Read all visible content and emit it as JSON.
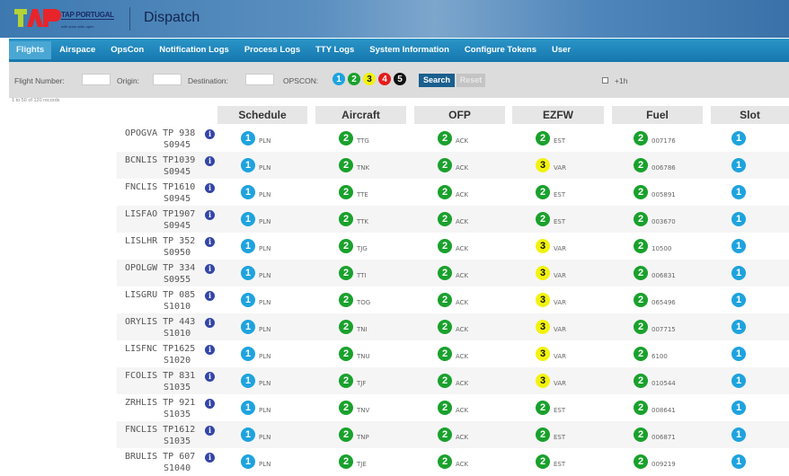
{
  "header": {
    "brand": "TAP PORTUGAL",
    "tagline": "with arms wide open",
    "app_title": "Dispatch",
    "logo_text": "TAP"
  },
  "nav": [
    "Flights",
    "Airspace",
    "OpsCon",
    "Notification Logs",
    "Process Logs",
    "TTY Logs",
    "System Information",
    "Configure Tokens",
    "User"
  ],
  "filters": {
    "flight_number": "Flight Number:",
    "origin": "Origin:",
    "destination": "Destination:",
    "opscon": "OPSCON:",
    "opscon_levels": [
      "1",
      "2",
      "3",
      "4",
      "5"
    ],
    "search": "Search",
    "reset": "Reset",
    "plus1h": "+1h"
  },
  "records": "1 to 50 of 120 records",
  "columns": [
    "Schedule",
    "Aircraft",
    "OFP",
    "EZFW",
    "Fuel",
    "Slot"
  ],
  "colors": {
    "1": "#1ea3de",
    "2": "#19a12c",
    "3": "#f2f20f",
    "4": "#e51d1d",
    "5": "#111111"
  },
  "rows": [
    {
      "route": "OPOGVA",
      "flight": "TP 938",
      "std": "S0945",
      "sched": [
        "1",
        "PLN"
      ],
      "ac": [
        "2",
        "TTG"
      ],
      "ofp": [
        "2",
        "ACK"
      ],
      "ezfw": [
        "2",
        "EST"
      ],
      "fuel": [
        "2",
        "007176"
      ],
      "slot": [
        "1",
        ""
      ]
    },
    {
      "route": "BCNLIS",
      "flight": "TP1039",
      "std": "S0945",
      "sched": [
        "1",
        "PLN"
      ],
      "ac": [
        "2",
        "TNK"
      ],
      "ofp": [
        "2",
        "ACK"
      ],
      "ezfw": [
        "3",
        "VAR"
      ],
      "fuel": [
        "2",
        "006786"
      ],
      "slot": [
        "1",
        ""
      ]
    },
    {
      "route": "FNCLIS",
      "flight": "TP1610",
      "std": "S0945",
      "sched": [
        "1",
        "PLN"
      ],
      "ac": [
        "2",
        "TTE"
      ],
      "ofp": [
        "2",
        "ACK"
      ],
      "ezfw": [
        "2",
        "EST"
      ],
      "fuel": [
        "2",
        "005891"
      ],
      "slot": [
        "1",
        ""
      ]
    },
    {
      "route": "LISFAO",
      "flight": "TP1907",
      "std": "S0945",
      "sched": [
        "1",
        "PLN"
      ],
      "ac": [
        "2",
        "TTK"
      ],
      "ofp": [
        "2",
        "ACK"
      ],
      "ezfw": [
        "2",
        "EST"
      ],
      "fuel": [
        "2",
        "003670"
      ],
      "slot": [
        "1",
        ""
      ]
    },
    {
      "route": "LISLHR",
      "flight": "TP 352",
      "std": "S0950",
      "sched": [
        "1",
        "PLN"
      ],
      "ac": [
        "2",
        "TJG"
      ],
      "ofp": [
        "2",
        "ACK"
      ],
      "ezfw": [
        "3",
        "VAR"
      ],
      "fuel": [
        "2",
        "10500"
      ],
      "slot": [
        "1",
        ""
      ]
    },
    {
      "route": "OPOLGW",
      "flight": "TP 334",
      "std": "S0955",
      "sched": [
        "1",
        "PLN"
      ],
      "ac": [
        "2",
        "TTI"
      ],
      "ofp": [
        "2",
        "ACK"
      ],
      "ezfw": [
        "3",
        "VAR"
      ],
      "fuel": [
        "2",
        "006831"
      ],
      "slot": [
        "1",
        ""
      ]
    },
    {
      "route": "LISGRU",
      "flight": "TP 085",
      "std": "S1010",
      "sched": [
        "1",
        "PLN"
      ],
      "ac": [
        "2",
        "TOG"
      ],
      "ofp": [
        "2",
        "ACK"
      ],
      "ezfw": [
        "3",
        "VAR"
      ],
      "fuel": [
        "2",
        "065496"
      ],
      "slot": [
        "1",
        ""
      ]
    },
    {
      "route": "ORYLIS",
      "flight": "TP 443",
      "std": "S1010",
      "sched": [
        "1",
        "PLN"
      ],
      "ac": [
        "2",
        "TNI"
      ],
      "ofp": [
        "2",
        "ACK"
      ],
      "ezfw": [
        "3",
        "VAR"
      ],
      "fuel": [
        "2",
        "007715"
      ],
      "slot": [
        "1",
        ""
      ]
    },
    {
      "route": "LISFNC",
      "flight": "TP1625",
      "std": "S1020",
      "sched": [
        "1",
        "PLN"
      ],
      "ac": [
        "2",
        "TNU"
      ],
      "ofp": [
        "2",
        "ACK"
      ],
      "ezfw": [
        "3",
        "VAR"
      ],
      "fuel": [
        "2",
        "6100"
      ],
      "slot": [
        "1",
        ""
      ]
    },
    {
      "route": "FCOLIS",
      "flight": "TP 831",
      "std": "S1035",
      "sched": [
        "1",
        "PLN"
      ],
      "ac": [
        "2",
        "TJF"
      ],
      "ofp": [
        "2",
        "ACK"
      ],
      "ezfw": [
        "3",
        "VAR"
      ],
      "fuel": [
        "2",
        "010544"
      ],
      "slot": [
        "1",
        ""
      ]
    },
    {
      "route": "ZRHLIS",
      "flight": "TP 921",
      "std": "S1035",
      "sched": [
        "1",
        "PLN"
      ],
      "ac": [
        "2",
        "TNV"
      ],
      "ofp": [
        "2",
        "ACK"
      ],
      "ezfw": [
        "2",
        "EST"
      ],
      "fuel": [
        "2",
        "008641"
      ],
      "slot": [
        "1",
        ""
      ]
    },
    {
      "route": "FNCLIS",
      "flight": "TP1612",
      "std": "S1035",
      "sched": [
        "1",
        "PLN"
      ],
      "ac": [
        "2",
        "TNP"
      ],
      "ofp": [
        "2",
        "ACK"
      ],
      "ezfw": [
        "2",
        "EST"
      ],
      "fuel": [
        "2",
        "006871"
      ],
      "slot": [
        "1",
        ""
      ]
    },
    {
      "route": "BRULIS",
      "flight": "TP 607",
      "std": "S1040",
      "sched": [
        "1",
        "PLN"
      ],
      "ac": [
        "2",
        "TJE"
      ],
      "ofp": [
        "2",
        "ACK"
      ],
      "ezfw": [
        "2",
        "EST"
      ],
      "fuel": [
        "2",
        "009219"
      ],
      "slot": [
        "1",
        ""
      ]
    }
  ]
}
